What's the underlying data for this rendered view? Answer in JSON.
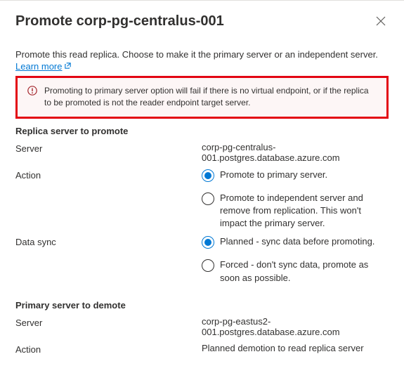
{
  "header": {
    "title": "Promote corp-pg-centralus-001"
  },
  "intro": {
    "text": "Promote this read replica. Choose to make it the primary server or an independent server.",
    "learn_more": "Learn more"
  },
  "alert": {
    "text": "Promoting to primary server option will fail if there is no virtual endpoint, or if the replica to be promoted is not the reader endpoint target server."
  },
  "replica": {
    "section_title": "Replica server to promote",
    "server_label": "Server",
    "server_value": "corp-pg-centralus-001.postgres.database.azure.com",
    "action_label": "Action",
    "action_options": {
      "primary": "Promote to primary server.",
      "independent": "Promote to independent server and remove from replication. This won't impact the primary server."
    },
    "data_sync_label": "Data sync",
    "data_sync_options": {
      "planned": "Planned - sync data before promoting.",
      "forced": "Forced - don't sync data, promote as soon as possible."
    }
  },
  "primary": {
    "section_title": "Primary server to demote",
    "server_label": "Server",
    "server_value": "corp-pg-eastus2-001.postgres.database.azure.com",
    "action_label": "Action",
    "action_value": "Planned demotion to read replica server"
  }
}
